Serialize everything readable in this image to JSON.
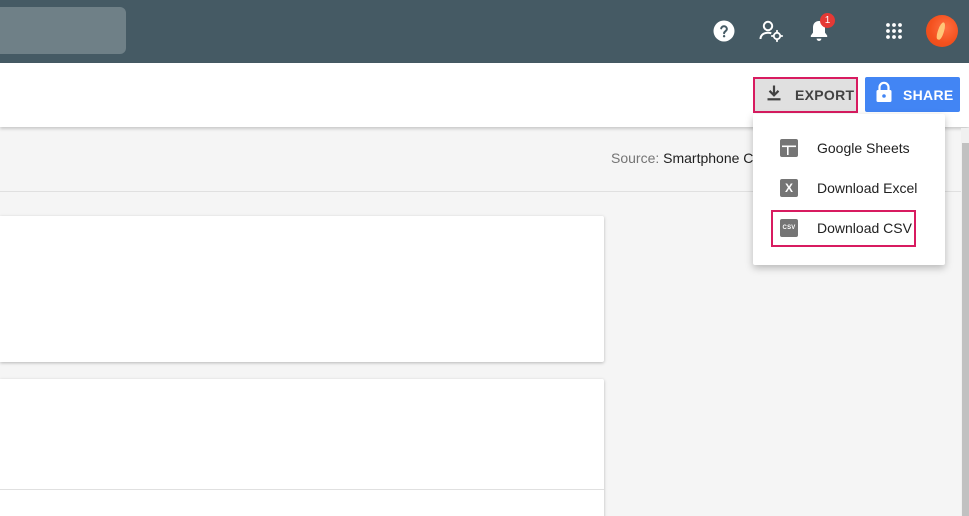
{
  "header": {
    "notification_count": "1",
    "colors": {
      "bar": "#455a64",
      "badge": "#e53935",
      "avatar": "#f4511e"
    }
  },
  "toolbar": {
    "export_label": "EXPORT",
    "share_label": "SHARE",
    "colors": {
      "share": "#4285f4",
      "highlight": "#d81b60"
    }
  },
  "source": {
    "label": "Source:",
    "value": "Smartphone C"
  },
  "export_menu": {
    "items": [
      {
        "label": "Google Sheets",
        "icon": "google-sheets-icon"
      },
      {
        "label": "Download Excel",
        "icon": "excel-icon"
      },
      {
        "label": "Download CSV",
        "icon": "csv-icon"
      }
    ]
  }
}
